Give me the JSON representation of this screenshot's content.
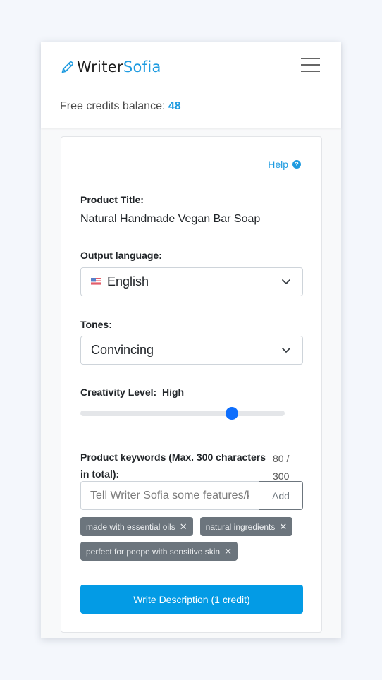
{
  "header": {
    "logo_part1": "Writer",
    "logo_part2": "Sofia",
    "logo_icon": "pencil-icon",
    "menu_icon": "hamburger-menu-icon",
    "credits_label": "Free credits balance:",
    "credits_value": "48"
  },
  "colors": {
    "brand": "#1e9be0",
    "primary_button": "#039be5",
    "slider_thumb": "#0d6efd",
    "tag_bg": "#6c757d"
  },
  "form": {
    "help_label": "Help",
    "help_icon": "question-circle-icon",
    "product_title_label": "Product Title:",
    "product_title_value": "Natural Handmade Vegan Bar Soap",
    "language_label": "Output language:",
    "language_flag": "us-flag-icon",
    "language_value": "English",
    "tones_label": "Tones:",
    "tones_value": "Convincing",
    "creativity_label": "Creativity Level:",
    "creativity_value": "High",
    "creativity_slider_percent": 74,
    "keywords_label": "Product keywords (Max. 300 characters in total):",
    "keywords_count": "80 /",
    "keywords_max": "300",
    "keywords_placeholder": "Tell Writer Sofia some features/keywords",
    "add_label": "Add",
    "tags": [
      {
        "label": "made with essential oils"
      },
      {
        "label": "natural ingredients"
      },
      {
        "label": "perfect for peope with sensitive skin"
      }
    ],
    "submit_label": "Write Description (1 credit)"
  }
}
